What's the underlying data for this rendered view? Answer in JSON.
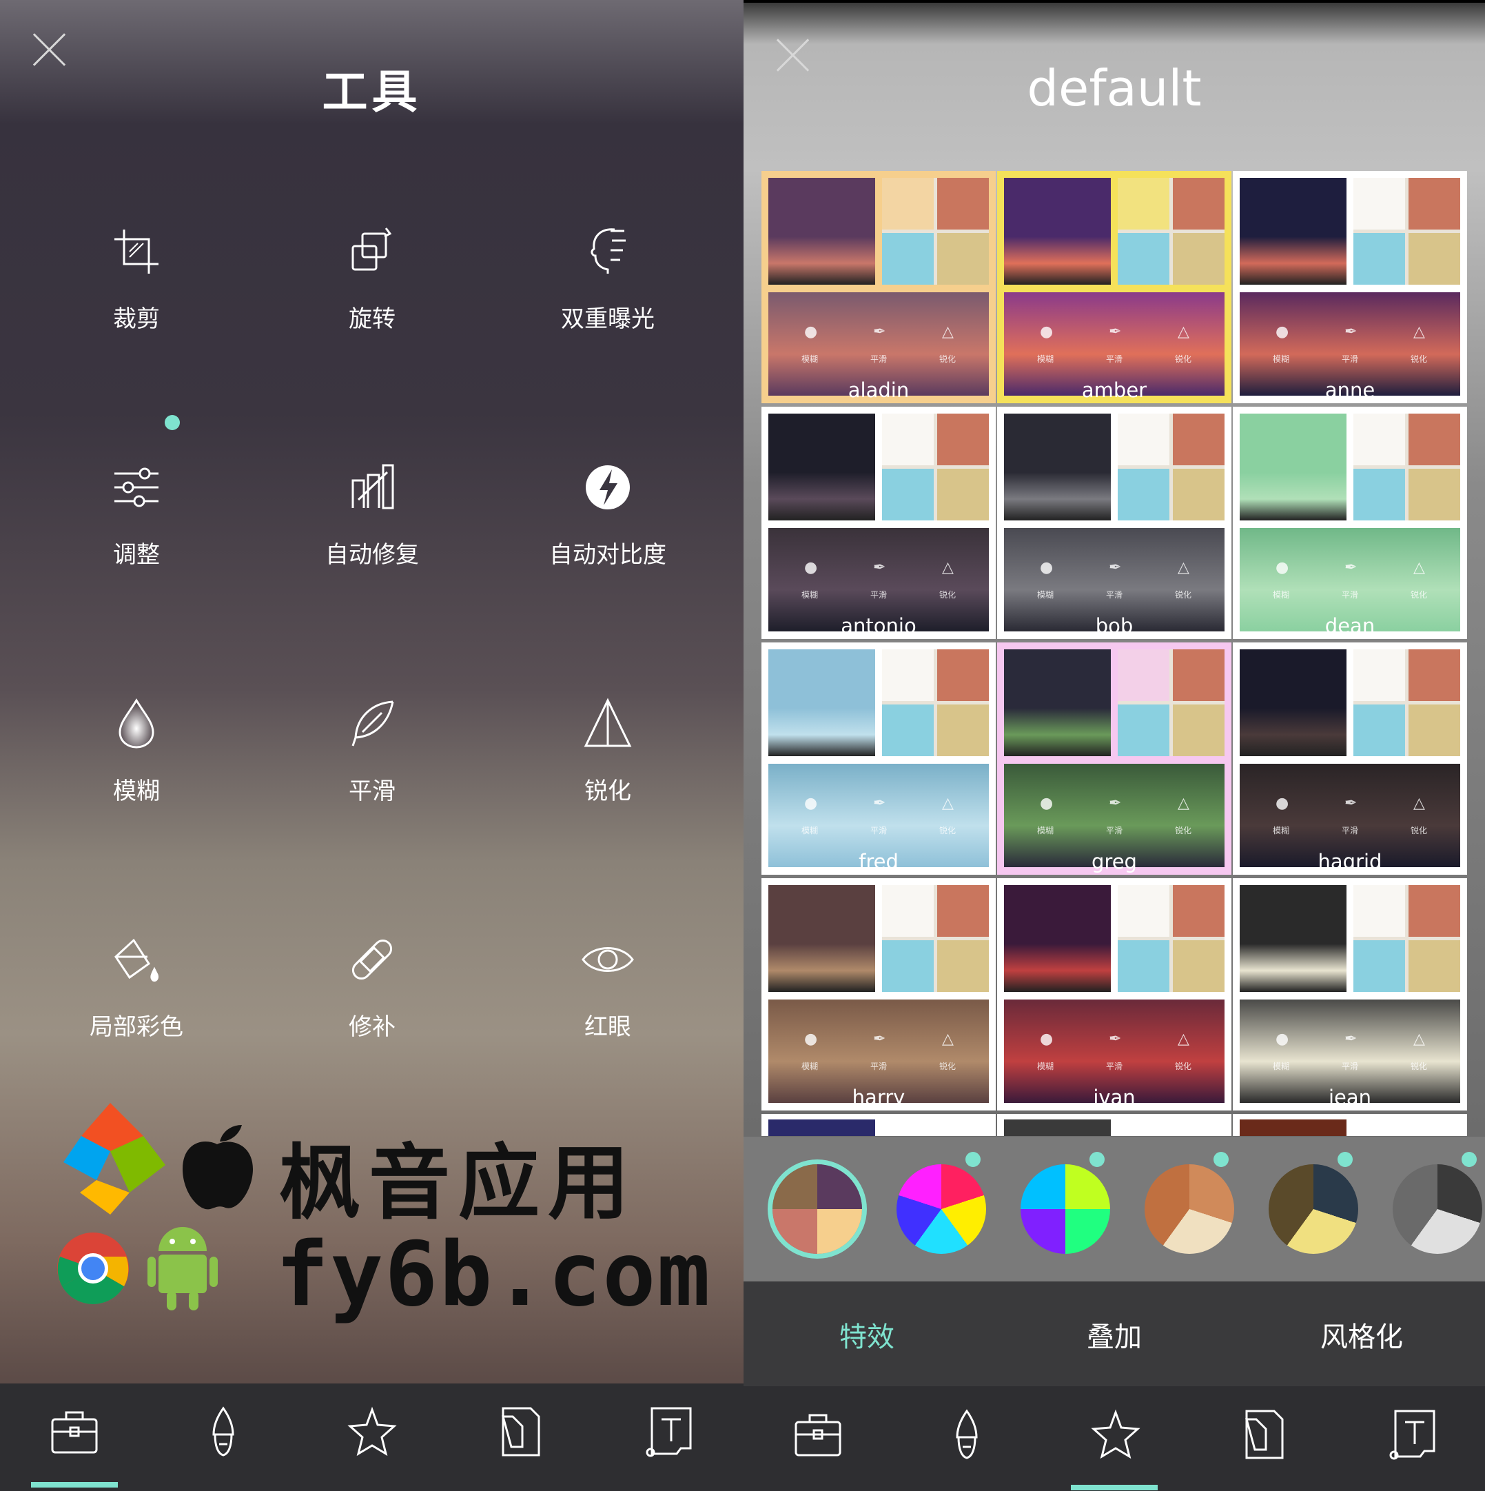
{
  "left_panel": {
    "title": "工具",
    "tools": [
      {
        "label": "裁剪",
        "icon": "crop-icon"
      },
      {
        "label": "旋转",
        "icon": "rotate-icon"
      },
      {
        "label": "双重曝光",
        "icon": "double-exposure-icon"
      },
      {
        "label": "调整",
        "icon": "sliders-icon",
        "new": true
      },
      {
        "label": "自动修复",
        "icon": "auto-fix-icon"
      },
      {
        "label": "自动对比度",
        "icon": "auto-contrast-icon"
      },
      {
        "label": "模糊",
        "icon": "blur-drop-icon"
      },
      {
        "label": "平滑",
        "icon": "feather-icon"
      },
      {
        "label": "锐化",
        "icon": "sharpen-triangle-icon"
      },
      {
        "label": "局部彩色",
        "icon": "paint-bucket-icon"
      },
      {
        "label": "修补",
        "icon": "bandage-icon"
      },
      {
        "label": "红眼",
        "icon": "eye-icon"
      }
    ]
  },
  "watermark": {
    "line1": "枫音应用",
    "line2": "fy6b.com"
  },
  "right_panel": {
    "title": "default",
    "filters": [
      "aladin",
      "amber",
      "anne",
      "antonio",
      "bob",
      "dean",
      "fred",
      "greg",
      "hagrid",
      "harry",
      "ivan",
      "jean"
    ],
    "mini_labels": [
      "模糊",
      "平滑",
      "锐化"
    ],
    "tabs": [
      "特效",
      "叠加",
      "风格化"
    ],
    "active_tab": 0
  },
  "bottom_nav": {
    "icons": [
      "toolbox-icon",
      "brush-icon",
      "effects-star-icon",
      "sticker-icon",
      "text-icon"
    ],
    "left_active": 0,
    "right_active": 2
  },
  "colors": {
    "accent": "#7fe3cf"
  }
}
